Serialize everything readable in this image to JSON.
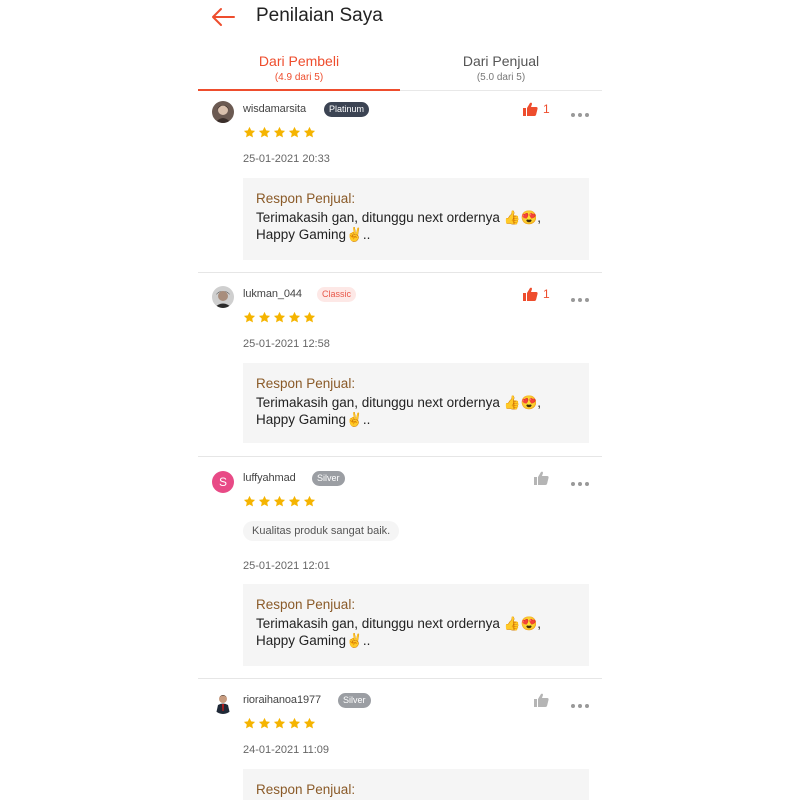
{
  "header": {
    "title": "Penilaian Saya"
  },
  "tabs": [
    {
      "label": "Dari Pembeli",
      "sub": "(4.9 dari 5)",
      "active": true
    },
    {
      "label": "Dari Penjual",
      "sub": "(5.0 dari 5)",
      "active": false
    }
  ],
  "colors": {
    "accent": "#ee4d2d",
    "star": "#f5b400",
    "response_title": "#8a5a28"
  },
  "reviews": [
    {
      "username": "wisdamarsita",
      "badge": "Platinum",
      "stars": 5,
      "likes": "1",
      "liked": true,
      "comment": "",
      "date": "25-01-2021 20:33",
      "response_title": "Respon Penjual:",
      "response_text": "Terimakasih gan, ditunggu next ordernya 👍😍,\nHappy Gaming✌.."
    },
    {
      "username": "lukman_044",
      "badge": "Classic",
      "stars": 5,
      "likes": "1",
      "liked": true,
      "comment": "",
      "date": "25-01-2021 12:58",
      "response_title": "Respon Penjual:",
      "response_text": "Terimakasih gan, ditunggu next ordernya 👍😍,\nHappy Gaming✌.."
    },
    {
      "username": "luffyahmad",
      "avatar_letter": "S",
      "badge": "Silver",
      "stars": 5,
      "likes": "",
      "liked": false,
      "comment": "Kualitas produk sangat baik.",
      "date": "25-01-2021 12:01",
      "response_title": "Respon Penjual:",
      "response_text": "Terimakasih gan, ditunggu next ordernya 👍😍,\nHappy Gaming✌.."
    },
    {
      "username": "rioraihanoa1977",
      "badge": "Silver",
      "stars": 5,
      "likes": "",
      "liked": false,
      "comment": "",
      "date": "24-01-2021 11:09",
      "response_title": "Respon Penjual:",
      "response_text": ""
    }
  ]
}
